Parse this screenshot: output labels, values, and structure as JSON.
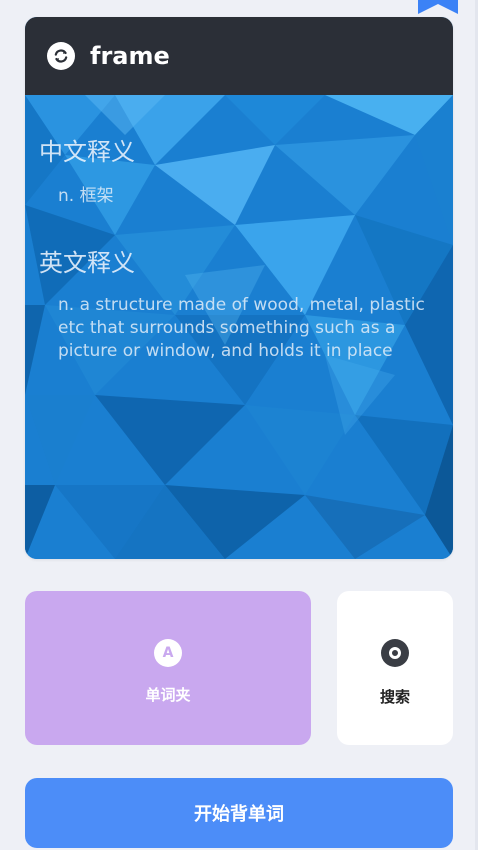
{
  "word": {
    "title": "frame"
  },
  "definitions": {
    "chinese_heading": "中文释义",
    "chinese_text": "n. 框架",
    "english_heading": "英文释义",
    "english_text": "n. a structure made of wood, metal, plastic etc that surrounds something such as a picture or window, and holds it in place"
  },
  "tiles": {
    "folder_icon_letter": "A",
    "folder_label": "单词夹",
    "search_label": "搜索"
  },
  "actions": {
    "start_label": "开始背单词"
  },
  "colors": {
    "header_bg": "#2b2f37",
    "card_bg": "#1a7fd1",
    "folder_tile": "#c9a8ef",
    "search_tile": "#ffffff",
    "start_button": "#4c8df8",
    "bookmark": "#3b82f6",
    "page_bg": "#eef0f6"
  },
  "icons": {
    "bookmark": "bookmark-icon",
    "refresh": "refresh-icon",
    "folder": "letter-a-icon",
    "search": "search-icon"
  }
}
